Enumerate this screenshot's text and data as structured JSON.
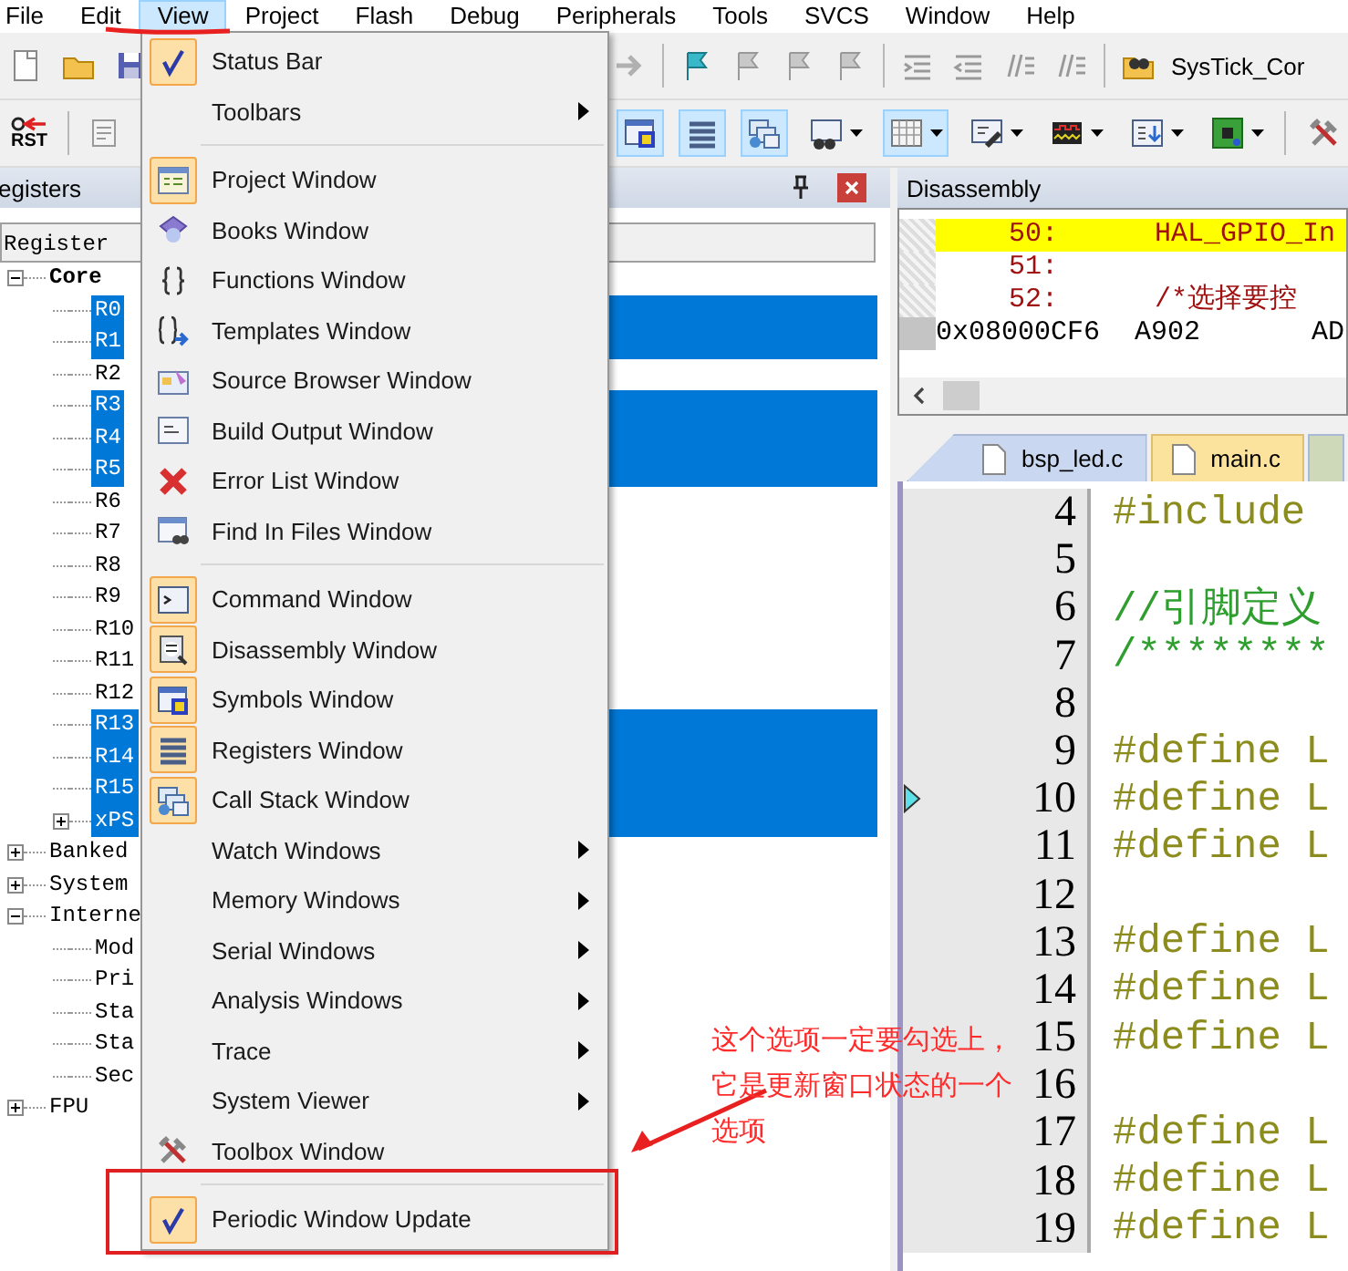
{
  "menu_bar": {
    "items": [
      {
        "label": "File",
        "selected": false
      },
      {
        "label": "Edit",
        "selected": false
      },
      {
        "label": "View",
        "selected": true
      },
      {
        "label": "Project",
        "selected": false
      },
      {
        "label": "Flash",
        "selected": false
      },
      {
        "label": "Debug",
        "selected": false
      },
      {
        "label": "Peripherals",
        "selected": false
      },
      {
        "label": "Tools",
        "selected": false
      },
      {
        "label": "SVCS",
        "selected": false
      },
      {
        "label": "Window",
        "selected": false
      },
      {
        "label": "Help",
        "selected": false
      }
    ]
  },
  "build_toolbar": {
    "target": "SysTick_Cor"
  },
  "debug_toolbar": {
    "reset_label": "RST",
    "buttons": [
      {
        "on": true,
        "dropdown": false
      },
      {
        "on": true,
        "dropdown": false
      },
      {
        "on": true,
        "dropdown": false
      },
      {
        "on": false,
        "dropdown": true
      },
      {
        "on": true,
        "dropdown": true
      },
      {
        "on": false,
        "dropdown": true
      },
      {
        "on": false,
        "dropdown": true
      },
      {
        "on": false,
        "dropdown": true
      },
      {
        "on": false,
        "dropdown": true
      },
      {
        "on": false,
        "dropdown": false
      }
    ]
  },
  "registers_panel": {
    "title": "egisters",
    "column": "Register",
    "tree": [
      {
        "label": "Core",
        "bold": true,
        "expanded": true,
        "selected": false,
        "children": [
          {
            "label": "R0",
            "selected": true
          },
          {
            "label": "R1",
            "selected": true
          },
          {
            "label": "R2",
            "selected": false
          },
          {
            "label": "R3",
            "selected": true
          },
          {
            "label": "R4",
            "selected": true
          },
          {
            "label": "R5",
            "selected": true
          },
          {
            "label": "R6",
            "selected": false
          },
          {
            "label": "R7",
            "selected": false
          },
          {
            "label": "R8",
            "selected": false
          },
          {
            "label": "R9",
            "selected": false
          },
          {
            "label": "R10",
            "selected": false
          },
          {
            "label": "R11",
            "selected": false
          },
          {
            "label": "R12",
            "selected": false
          },
          {
            "label": "R13",
            "selected": true
          },
          {
            "label": "R14",
            "selected": true
          },
          {
            "label": "R15",
            "selected": true
          },
          {
            "label": "xPS",
            "expanded": false,
            "selected": true
          }
        ]
      },
      {
        "label": "Banked",
        "bold": false,
        "expanded": false,
        "selected": false
      },
      {
        "label": "System",
        "bold": false,
        "expanded": false,
        "selected": false
      },
      {
        "label": "Interne",
        "bold": false,
        "expanded": true,
        "selected": false,
        "children": [
          {
            "label": "Mod",
            "selected": false
          },
          {
            "label": "Pri",
            "selected": false
          },
          {
            "label": "Sta",
            "selected": false
          },
          {
            "label": "Sta",
            "selected": false
          },
          {
            "label": "Sec",
            "selected": false
          }
        ]
      },
      {
        "label": "FPU",
        "bold": false,
        "expanded": false,
        "selected": false
      }
    ]
  },
  "disassembly": {
    "title": "Disassembly",
    "rows": [
      {
        "kind": "source",
        "line": "50:",
        "code": "HAL_GPIO_In",
        "current": true
      },
      {
        "kind": "source",
        "line": "51:",
        "current": false
      },
      {
        "kind": "source",
        "line": "52:",
        "code": "/*选择要控",
        "current": false
      },
      {
        "kind": "asm",
        "address": "0x08000CF6",
        "opcode": "A902",
        "mnemonic": "AD",
        "current": false
      }
    ]
  },
  "editor": {
    "tabs": [
      {
        "label": "bsp_led.c",
        "selected": false
      },
      {
        "label": "main.c",
        "selected": true
      }
    ],
    "lines": [
      {
        "number": "4",
        "kind": "directive",
        "code": "#include",
        "marker": false
      },
      {
        "number": "5",
        "kind": "blank",
        "marker": false
      },
      {
        "number": "6",
        "kind": "comment",
        "code": "//引脚定义",
        "marker": false
      },
      {
        "number": "7",
        "kind": "comment",
        "code": "/********",
        "marker": false
      },
      {
        "number": "8",
        "kind": "blank",
        "marker": false
      },
      {
        "number": "9",
        "kind": "directive",
        "code": "#define L",
        "marker": false
      },
      {
        "number": "10",
        "kind": "directive",
        "code": "#define L",
        "marker": true
      },
      {
        "number": "11",
        "kind": "directive",
        "code": "#define L",
        "marker": false
      },
      {
        "number": "12",
        "kind": "blank",
        "marker": false
      },
      {
        "number": "13",
        "kind": "directive",
        "code": "#define L",
        "marker": false
      },
      {
        "number": "14",
        "kind": "directive",
        "code": "#define L",
        "marker": false
      },
      {
        "number": "15",
        "kind": "directive",
        "code": "#define L",
        "marker": false
      },
      {
        "number": "16",
        "kind": "blank",
        "marker": false
      },
      {
        "number": "17",
        "kind": "directive",
        "code": "#define L",
        "marker": false
      },
      {
        "number": "18",
        "kind": "directive",
        "code": "#define L",
        "marker": false
      },
      {
        "number": "19",
        "kind": "directive",
        "code": "#define L",
        "marker": false
      }
    ]
  },
  "view_menu": {
    "items": [
      {
        "kind": "check",
        "label": "Status Bar",
        "checked": true
      },
      {
        "kind": "submenu",
        "label": "Toolbars"
      },
      {
        "kind": "separator"
      },
      {
        "kind": "window",
        "label": "Project Window",
        "checked": true
      },
      {
        "kind": "window",
        "label": "Books Window",
        "checked": false
      },
      {
        "kind": "window",
        "label": "Functions Window",
        "checked": false
      },
      {
        "kind": "window",
        "label": "Templates Window",
        "checked": false
      },
      {
        "kind": "window",
        "label": "Source Browser Window",
        "checked": false
      },
      {
        "kind": "window",
        "label": "Build Output Window",
        "checked": false
      },
      {
        "kind": "window",
        "label": "Error List Window",
        "checked": false
      },
      {
        "kind": "window",
        "label": "Find In Files Window",
        "checked": false
      },
      {
        "kind": "separator"
      },
      {
        "kind": "window",
        "label": "Command Window",
        "checked": true
      },
      {
        "kind": "window",
        "label": "Disassembly Window",
        "checked": true
      },
      {
        "kind": "window",
        "label": "Symbols Window",
        "checked": true
      },
      {
        "kind": "window",
        "label": "Registers Window",
        "checked": true
      },
      {
        "kind": "window",
        "label": "Call Stack Window",
        "checked": true
      },
      {
        "kind": "submenu",
        "label": "Watch Windows"
      },
      {
        "kind": "submenu",
        "label": "Memory Windows"
      },
      {
        "kind": "submenu",
        "label": "Serial Windows"
      },
      {
        "kind": "submenu",
        "label": "Analysis Windows"
      },
      {
        "kind": "submenu",
        "label": "Trace"
      },
      {
        "kind": "submenu",
        "label": "System Viewer"
      },
      {
        "kind": "window",
        "label": "Toolbox Window",
        "checked": false
      },
      {
        "kind": "separator"
      },
      {
        "kind": "check",
        "label": "Periodic Window Update",
        "checked": true
      }
    ]
  },
  "annotation": {
    "lines": [
      "这个选项一定要勾选上，",
      "它是更新窗口状态的一个",
      "选项"
    ]
  }
}
